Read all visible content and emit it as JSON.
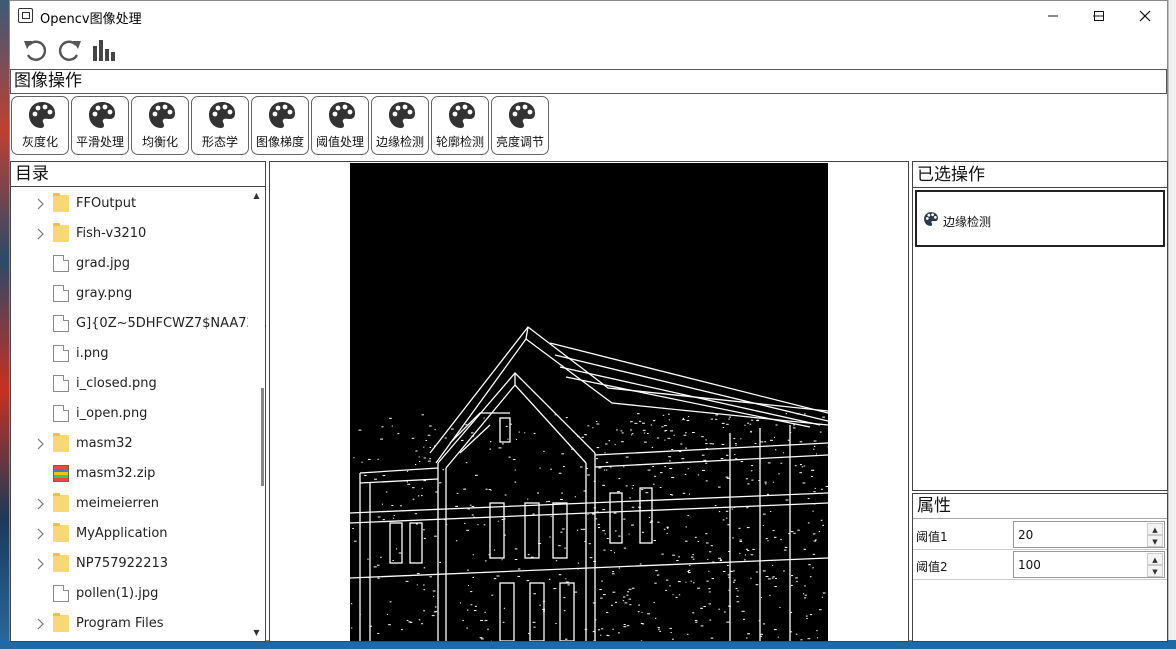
{
  "window": {
    "title": "Opencv图像处理"
  },
  "section_ops": {
    "title": "图像操作",
    "buttons": [
      {
        "label": "灰度化"
      },
      {
        "label": "平滑处理"
      },
      {
        "label": "均衡化"
      },
      {
        "label": "形态学"
      },
      {
        "label": "图像梯度"
      },
      {
        "label": "阈值处理"
      },
      {
        "label": "边缘检测"
      },
      {
        "label": "轮廓检测"
      },
      {
        "label": "亮度调节"
      }
    ]
  },
  "directory": {
    "title": "目录",
    "items": [
      {
        "name": "FFOutput",
        "type": "folder"
      },
      {
        "name": "Fish-v3210",
        "type": "folder"
      },
      {
        "name": "grad.jpg",
        "type": "file"
      },
      {
        "name": "gray.png",
        "type": "file"
      },
      {
        "name": "G]{0Z~5DHFCWZ7$NAA72...",
        "type": "file"
      },
      {
        "name": "i.png",
        "type": "file"
      },
      {
        "name": "i_closed.png",
        "type": "file"
      },
      {
        "name": "i_open.png",
        "type": "file"
      },
      {
        "name": "masm32",
        "type": "folder"
      },
      {
        "name": "masm32.zip",
        "type": "zip"
      },
      {
        "name": "meimeierren",
        "type": "folder"
      },
      {
        "name": "MyApplication",
        "type": "folder"
      },
      {
        "name": "NP757922213",
        "type": "folder"
      },
      {
        "name": "pollen(1).jpg",
        "type": "file"
      },
      {
        "name": "Program Files",
        "type": "folder"
      }
    ]
  },
  "selected_ops": {
    "title": "已选操作",
    "items": [
      {
        "label": "边缘检测"
      }
    ]
  },
  "properties": {
    "title": "属性",
    "rows": [
      {
        "name": "阈值1",
        "value": "20"
      },
      {
        "name": "阈值2",
        "value": "100"
      }
    ]
  },
  "icons": {
    "undo": "undo-icon",
    "redo": "redo-icon",
    "histogram": "histogram-icon",
    "palette": "palette-icon"
  }
}
